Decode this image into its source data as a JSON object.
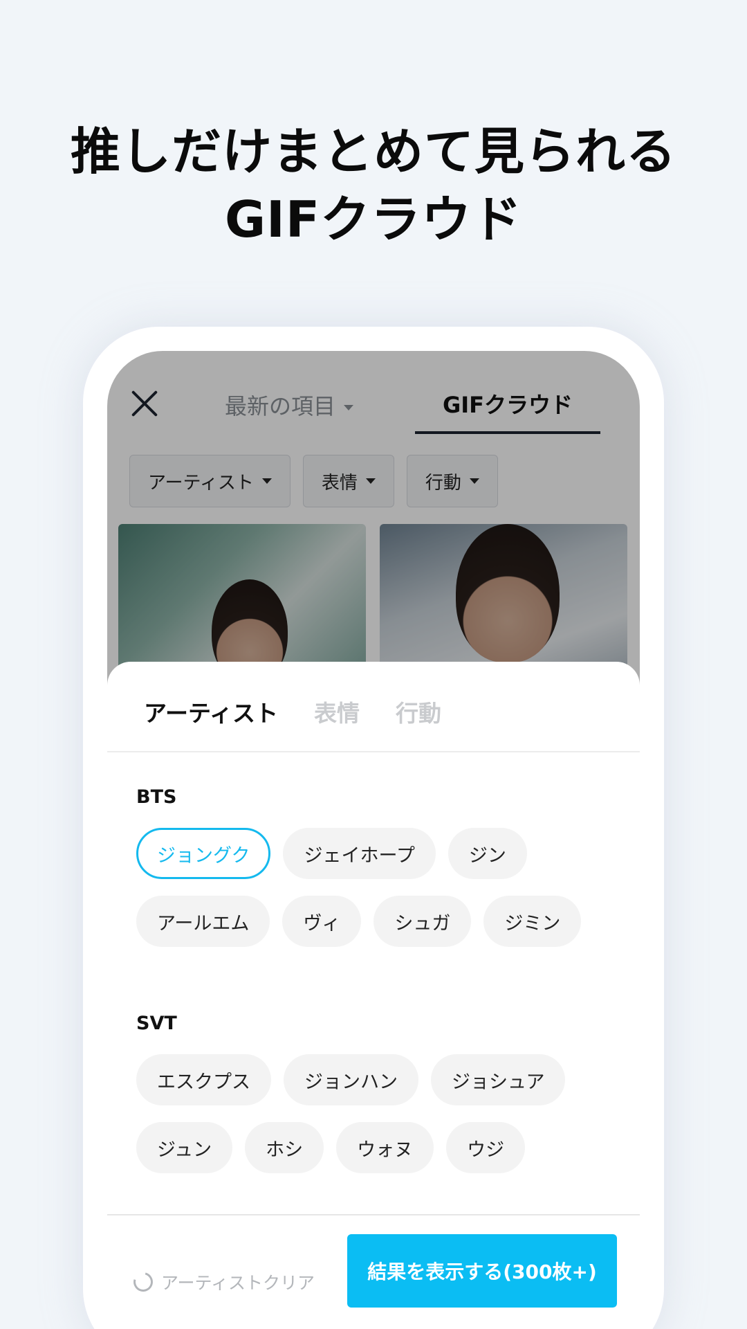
{
  "headline": {
    "line1": "推しだけまとめて見られる",
    "line2": "GIFクラウド"
  },
  "app": {
    "tabs": {
      "latest": "最新の項目",
      "gif_cloud": "GIFクラウド"
    },
    "filters": [
      "アーティスト",
      "表情",
      "行動"
    ]
  },
  "sheet": {
    "tabs": [
      "アーティスト",
      "表情",
      "行動"
    ],
    "active_tab": "アーティスト",
    "groups": [
      {
        "title": "BTS",
        "members": [
          "ジョングク",
          "ジェイホープ",
          "ジン",
          "アールエム",
          "ヴィ",
          "シュガ",
          "ジミン"
        ],
        "selected": "ジョングク"
      },
      {
        "title": "SVT",
        "members": [
          "エスクプス",
          "ジョンハン",
          "ジョシュア",
          "ジュン",
          "ホシ",
          "ウォヌ",
          "ウジ"
        ]
      }
    ]
  },
  "footer": {
    "clear_label": "アーティストクリア",
    "show_label": "結果を表示する(300枚+)"
  },
  "colors": {
    "accent": "#0bbdf3",
    "selected_chip": "#14b9ee",
    "background": "#f1f5f9"
  }
}
